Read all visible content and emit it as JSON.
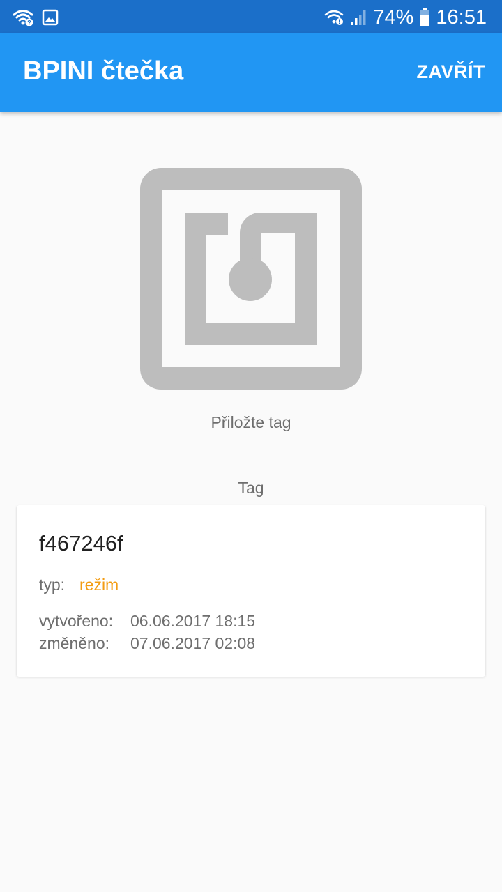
{
  "status_bar": {
    "left_icons": [
      "wifi-question-icon",
      "image-icon"
    ],
    "right_icons": [
      "wifi-alert-icon",
      "signal-icon",
      "battery-icon"
    ],
    "battery": "74%",
    "time": "16:51"
  },
  "app_bar": {
    "title": "BPINI čtečka",
    "close_label": "ZAVŘÍT",
    "color": "#2196f3"
  },
  "scan": {
    "icon": "nfc-icon",
    "prompt": "Přiložte tag"
  },
  "tag_section": {
    "label": "Tag"
  },
  "tag_card": {
    "id": "f467246f",
    "type_label": "typ:",
    "type_value": "režim",
    "type_value_color": "#f39c12",
    "created_label": "vytvořeno:",
    "created_value": "06.06.2017 18:15",
    "modified_label": "změněno:",
    "modified_value": "07.06.2017 02:08"
  }
}
